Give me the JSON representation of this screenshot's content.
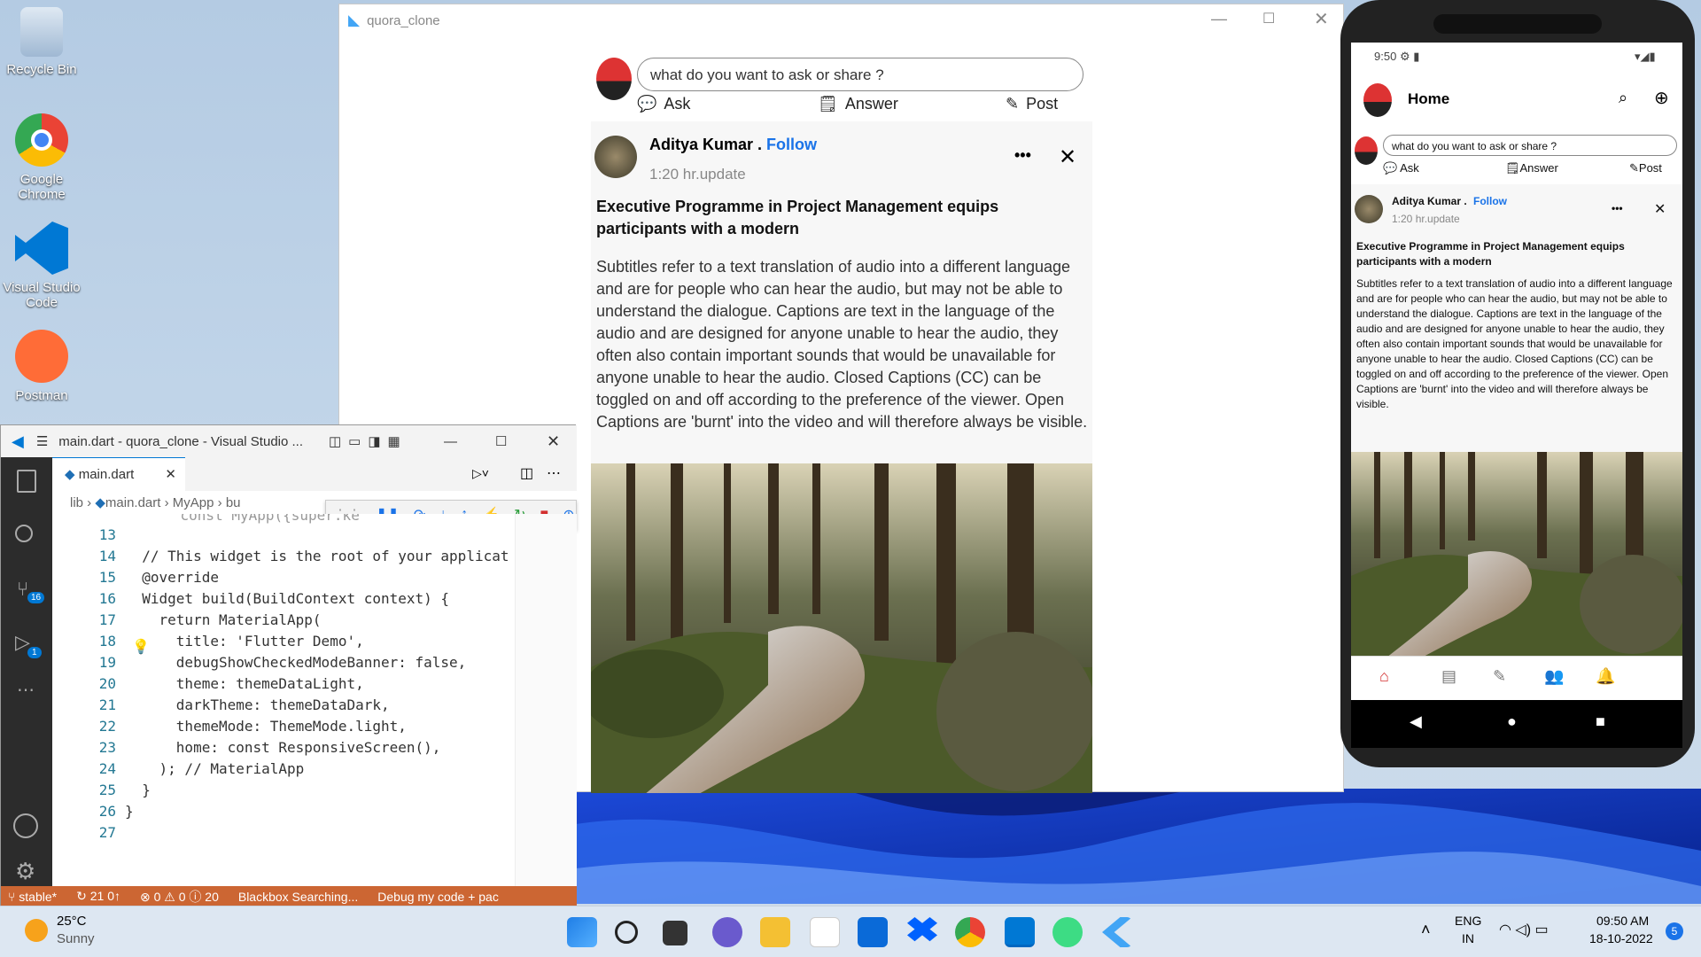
{
  "desktop": {
    "icons": [
      {
        "label": "Recycle Bin"
      },
      {
        "label": "Google Chrome"
      },
      {
        "label": "Visual Studio Code"
      },
      {
        "label": "Postman"
      }
    ]
  },
  "flutter": {
    "title": "quora_clone",
    "question_placeholder": "what do you want to ask or share ?",
    "actions": {
      "ask": "Ask",
      "answer": "Answer",
      "post": "Post"
    },
    "post": {
      "author": "Aditya Kumar .",
      "follow": "Follow",
      "time": "1:20 hr.update",
      "title": "Executive Programme in Project Management equips participants with a modern",
      "body": "Subtitles refer to a text translation of audio into a different language and are for people who can hear the audio, but may not be able to understand the dialogue. Captions are text in the language of the audio and are designed for anyone unable to hear the audio, they often also contain important sounds that would be unavailable for anyone unable to hear the audio. Closed Captions (CC) can be toggled on and off according to the preference of the viewer. Open Captions are 'burnt' into the video and will therefore always be visible.",
      "more": "•••",
      "close": "✕"
    }
  },
  "vscode": {
    "title": "main.dart - quora_clone - Visual Studio ...",
    "tab": "main.dart",
    "breadcrumb": [
      "lib",
      "main.dart",
      "MyApp",
      "bu"
    ],
    "activity_badges": {
      "scm": "16",
      "debug": "1"
    },
    "code_lines": [
      {
        "n": "13",
        "t": ""
      },
      {
        "n": "14",
        "t": "  // This widget is the root of your applicat"
      },
      {
        "n": "15",
        "t": "  @override"
      },
      {
        "n": "16",
        "t": "  Widget build(BuildContext context) {"
      },
      {
        "n": "17",
        "t": "    return MaterialApp("
      },
      {
        "n": "18",
        "t": "      title: 'Flutter Demo',"
      },
      {
        "n": "19",
        "t": "      debugShowCheckedModeBanner: false,"
      },
      {
        "n": "20",
        "t": "      theme: themeDataLight,"
      },
      {
        "n": "21",
        "t": "      darkTheme: themeDataDark,"
      },
      {
        "n": "22",
        "t": "      themeMode: ThemeMode.light,"
      },
      {
        "n": "23",
        "t": "      home: const ResponsiveScreen(),"
      },
      {
        "n": "24",
        "t": "    ); // MaterialApp"
      },
      {
        "n": "25",
        "t": "  }"
      },
      {
        "n": "26",
        "t": "}"
      },
      {
        "n": "27",
        "t": ""
      }
    ],
    "partial_top_line": "    const MyApp({super.ke",
    "status": {
      "branch": "stable*",
      "sync": "21 0↑",
      "problems": "⊗ 0 ⚠ 0 ⓘ 20",
      "blackbox": "Blackbox Searching...",
      "debug": "Debug my code + pac"
    }
  },
  "phone": {
    "time": "9:50",
    "app_title": "Home",
    "question_placeholder": "what do you want to ask or share ?",
    "actions": {
      "ask": "Ask",
      "answer": "Answer",
      "post": "Post"
    }
  },
  "taskbar": {
    "weather_temp": "25°C",
    "weather_desc": "Sunny",
    "lang1": "ENG",
    "lang2": "IN",
    "time": "09:50 AM",
    "date": "18-10-2022",
    "notif": "5"
  },
  "colors": {
    "accent": "#1a73e8",
    "vscode_status": "#cc6633",
    "vscode_activity": "#2c2c2c",
    "home_icon": "#d32f2f"
  }
}
